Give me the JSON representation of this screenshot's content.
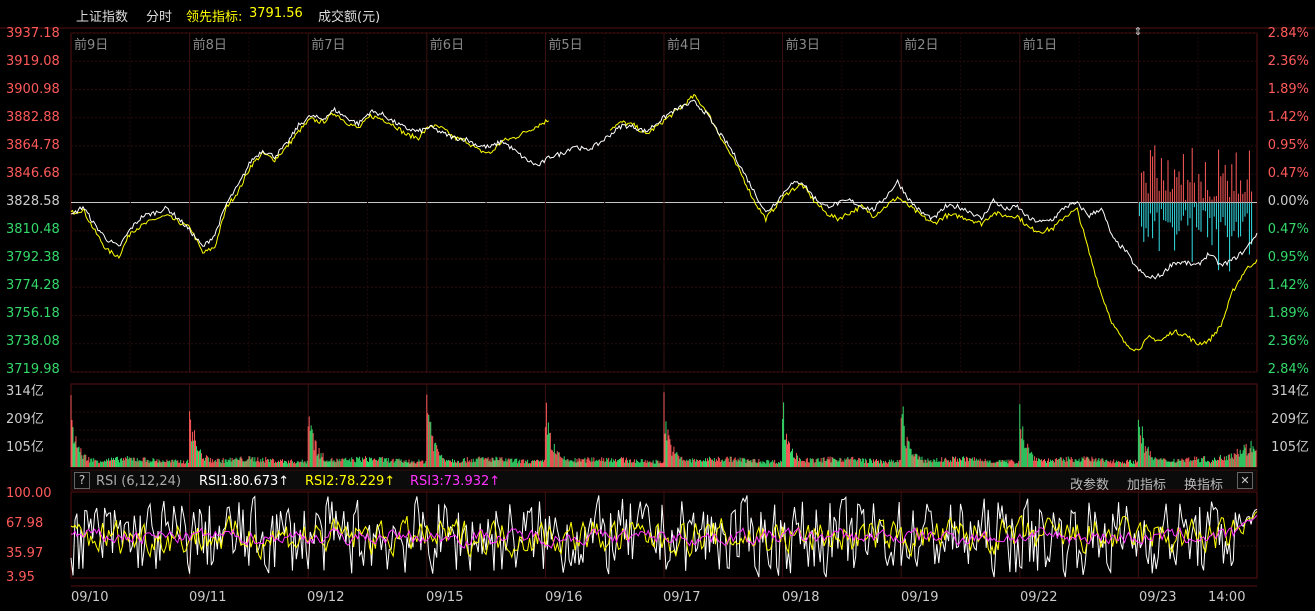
{
  "header": {
    "index_name": "上证指数",
    "mode": "分时",
    "leading_label": "领先指标:",
    "leading_value": "3791.56",
    "volume_label": "成交额(元)"
  },
  "colors": {
    "up": "#ff5a5a",
    "down": "#34d96a",
    "flat": "#cccccc",
    "price_line": "#ffffff",
    "leading_line": "#ffff00",
    "rsi1": "#ffffff",
    "rsi2": "#ffff00",
    "rsi3": "#ff33ff",
    "cyan": "#33e0e8",
    "grid": "#2a0a0a"
  },
  "icons": {
    "drag_handle": "up-down-arrow-icon",
    "help": "question-icon",
    "close": "close-icon"
  },
  "indicator": {
    "help_symbol": "?",
    "name": "RSI (6,12,24)",
    "rsi1": "RSI1:80.673↑",
    "rsi2": "RSI2:78.229↑",
    "rsi3": "RSI3:73.932↑",
    "buttons": [
      "改参数",
      "加指标",
      "换指标"
    ],
    "close_symbol": "✕"
  },
  "chart_data": [
    {
      "type": "line",
      "name": "price",
      "day_labels": [
        "前9日",
        "前8日",
        "前7日",
        "前6日",
        "前5日",
        "前4日",
        "前3日",
        "前2日",
        "前1日"
      ],
      "y_ticks": [
        "3937.18",
        "3919.08",
        "3900.98",
        "3882.88",
        "3864.78",
        "3846.68",
        "3828.58",
        "3810.48",
        "3792.38",
        "3774.28",
        "3756.18",
        "3738.08",
        "3719.98"
      ],
      "pct_ticks": [
        "2.84%",
        "2.36%",
        "1.89%",
        "1.42%",
        "0.95%",
        "0.47%",
        "0.00%",
        "0.47%",
        "0.95%",
        "1.42%",
        "1.89%",
        "2.36%",
        "2.84%"
      ],
      "ylim": [
        3719.98,
        3937.18
      ],
      "base": 3828.58,
      "series": [
        {
          "name": "",
          "values": [
            3820,
            3826,
            3814,
            3805,
            3800,
            3812,
            3820,
            3822,
            3825,
            3818,
            3810,
            3800,
            3808,
            3828,
            3840,
            3855,
            3862,
            3858,
            3866,
            3878,
            3884,
            3882,
            3888,
            3883,
            3879,
            3887,
            3885,
            3880,
            3876,
            3874,
            3877,
            3873,
            3870,
            3869,
            3865,
            3864,
            3868,
            3862,
            3856,
            3852,
            3858,
            3860,
            3865,
            3862,
            3866,
            3872,
            3878,
            3877,
            3874,
            3880,
            3886,
            3890,
            3893,
            3886,
            3874,
            3864,
            3850,
            3836,
            3822,
            3830,
            3840,
            3842,
            3832,
            3826,
            3828,
            3830,
            3826,
            3824,
            3832,
            3842,
            3830,
            3822,
            3818,
            3826,
            3826,
            3823,
            3818,
            3830,
            3824,
            3826,
            3818,
            3816,
            3818,
            3826,
            3828,
            3820,
            3825,
            3805,
            3798,
            3786,
            3780,
            3782,
            3790,
            3790,
            3788,
            3796,
            3788,
            3792,
            3798,
            3809
          ]
        },
        {
          "name": "",
          "values": [
            3822,
            3824,
            3810,
            3798,
            3794,
            3810,
            3814,
            3818,
            3820,
            3816,
            3812,
            3796,
            3800,
            3826,
            3836,
            3852,
            3860,
            3856,
            3864,
            3874,
            3882,
            3880,
            3886,
            3880,
            3876,
            3884,
            3882,
            3878,
            3872,
            3870,
            3878,
            3876,
            3870,
            3868,
            3862,
            3860,
            3868,
            3870,
            3874,
            3878,
            3882,
            3885,
            3884,
            3878,
            3872,
            3876,
            3880,
            3878,
            3872,
            3878,
            3884,
            3890,
            3897,
            3888,
            3874,
            3860,
            3846,
            3830,
            3818,
            3828,
            3836,
            3840,
            3830,
            3822,
            3818,
            3822,
            3826,
            3820,
            3826,
            3832,
            3826,
            3820,
            3815,
            3820,
            3820,
            3818,
            3815,
            3822,
            3820,
            3820,
            3812,
            3810,
            3812,
            3820,
            3824,
            3796,
            3770,
            3750,
            3738,
            3734,
            3742,
            3740,
            3746,
            3744,
            3738,
            3740,
            3750,
            3772,
            3785,
            3792
          ]
        }
      ],
      "yellow_gap": [
        40,
        41,
        42,
        43,
        44
      ]
    },
    {
      "type": "bar",
      "name": "turnover",
      "y_ticks": [
        "314亿",
        "209亿",
        "105亿"
      ],
      "ylim": [
        0,
        314
      ],
      "days": 10,
      "day_peaks": [
        198,
        212,
        235,
        272,
        224,
        212,
        210,
        238,
        214,
        202
      ],
      "day_trough": 20,
      "last_day_end": 82
    },
    {
      "type": "line",
      "name": "rsi",
      "y_ticks": [
        "100.00",
        "67.98",
        "35.97",
        "3.95"
      ],
      "ylim": [
        3.95,
        100.0
      ],
      "last_values": {
        "rsi1": 80.673,
        "rsi2": 78.229,
        "rsi3": 73.932
      }
    }
  ],
  "x_labels": [
    "09/10",
    "09/11",
    "09/12",
    "09/15",
    "09/16",
    "09/17",
    "09/18",
    "09/19",
    "09/22",
    "09/23",
    "14:00"
  ]
}
